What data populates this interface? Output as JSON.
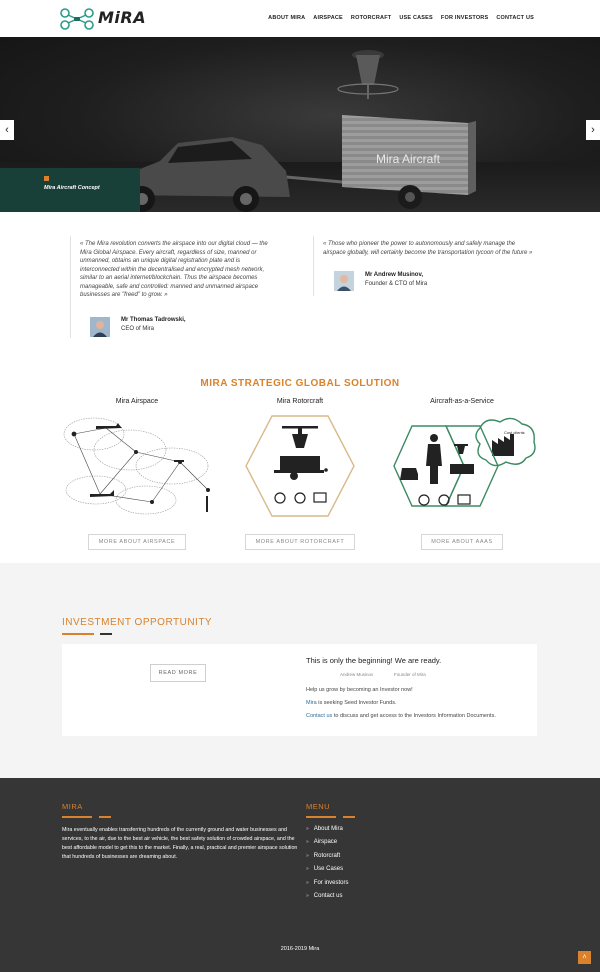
{
  "header": {
    "logo_text": "MiRA",
    "nav": [
      "ABOUT MIRA",
      "AIRSPACE",
      "ROTORCRAFT",
      "USE CASES",
      "FOR INVESTORS",
      "CONTACT US"
    ]
  },
  "hero": {
    "caption": "Mira Aircraft Concept",
    "trailer_text": "Mira Aircraft",
    "prev_icon": "chevron-left-icon",
    "next_icon": "chevron-right-icon"
  },
  "quotes": [
    {
      "text": "« The Mira revolution converts the airspace into our digital cloud — the Mira Global Airspace. Every aircraft, regardless of size, manned or unmanned, obtains an unique digital registration plate and is interconnected within the decentralised and encrypted mesh network, similar to an aerial internet/blockchain. Thus the airspace becomes manageable, safe and controlled: manned and unmanned airspace businesses are \"freed\" to grow. »",
      "name": "Mr Thomas Tadrowski,",
      "role": "CEO of Mira"
    },
    {
      "text": "« Those who pioneer the power to autonomously and safely manage the airspace globally, will certainly become the transportation tycoon of the future »",
      "name": "Mr Andrew Musinov,",
      "role": "Founder & CTO of Mira"
    }
  ],
  "solutions": {
    "title": "MIRA STRATEGIC GLOBAL SOLUTION",
    "items": [
      {
        "title": "Mira Airspace",
        "button": "MORE ABOUT AIRSPACE"
      },
      {
        "title": "Mira Rotorcraft",
        "button": "MORE ABOUT ROTORCRAFT"
      },
      {
        "title": "Aircraft-as-a-Service",
        "button": "MORE ABOUT AAAS",
        "cloud_label": "Cost clients"
      }
    ]
  },
  "investment": {
    "title": "INVESTMENT OPPORTUNITY",
    "read_more": "READ MORE",
    "headline": "This is only the beginning! We are ready.",
    "signatures": [
      "Andrew Musinov",
      "Founder of Mira"
    ],
    "line1": "Help us grow by becoming an Investor now!",
    "line2_hl": "Mira",
    "line2_rest": " is seeking Seed Investor Funds.",
    "line3_hl": "Contact us",
    "line3_rest": " to discuss and get access to the Investors Information Documents."
  },
  "footer": {
    "about_title": "MIRA",
    "about_text": "Mira eventually enables transferring hundreds of the currently ground and water businesses and services, to the air, due to the best air vehicle, the best safety solution of crowded airspace, and the best affordable model to get this to the market. Finally, a real, practical and premier airspace solution that hundreds of businesses are dreaming about.",
    "menu_title": "MENU",
    "menu": [
      "About Mira",
      "Airspace",
      "Rotorcraft",
      "Use Cases",
      "For investors",
      "Contact us"
    ],
    "copyright": "2016-2019 Mira",
    "to_top_icon": "chevron-up-icon"
  },
  "colors": {
    "accent": "#d9822b",
    "teal": "#183f38",
    "footer_bg": "#363636",
    "link": "#2a6f9a"
  }
}
